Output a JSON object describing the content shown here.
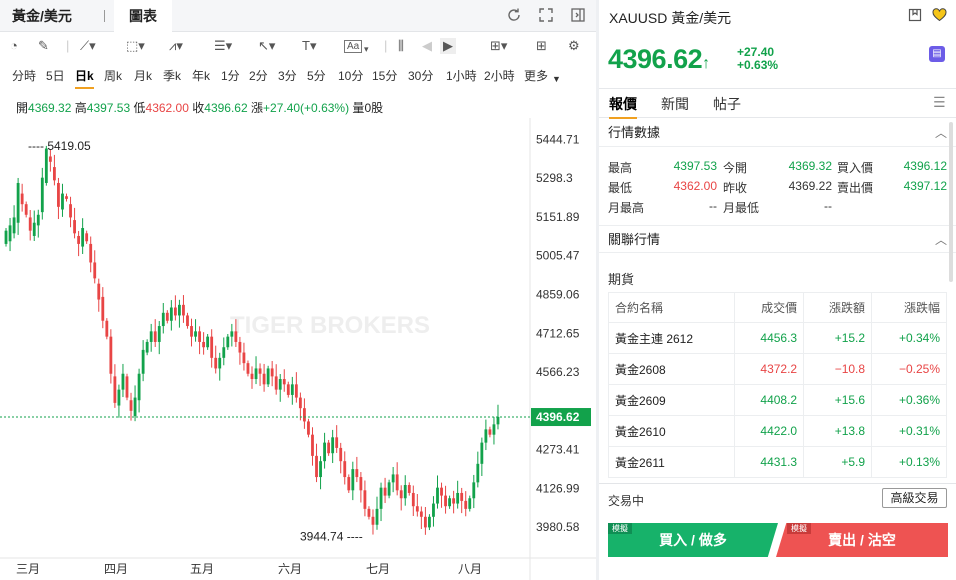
{
  "tabs": [
    {
      "label": "黃金/美元"
    },
    {
      "label": "圖表"
    }
  ],
  "toolbar": {
    "indicator_label": "Aa"
  },
  "periods": [
    "分時",
    "5日",
    "日k",
    "周k",
    "月k",
    "季k",
    "年k",
    "1分",
    "2分",
    "3分",
    "5分",
    "10分",
    "15分",
    "30分",
    "1小時",
    "2小時",
    "更多"
  ],
  "active_period": "日k",
  "ohlc": {
    "open_label": "開",
    "open": "4369.32",
    "high_label": "高",
    "high": "4397.53",
    "low_label": "低",
    "low": "4362.00",
    "close_label": "收",
    "close": "4396.62",
    "change_label": "漲",
    "change": "+27.40(+0.63%)",
    "volume_label": "量",
    "volume": "0股"
  },
  "chart_data": {
    "type": "candlestick",
    "y_ticks": [
      5444.71,
      5298.3,
      5151.89,
      5005.47,
      4859.06,
      4712.65,
      4566.23,
      4273.41,
      4126.99,
      3980.58
    ],
    "ylim": [
      3940,
      5480
    ],
    "x_ticks": [
      "三月",
      "四月",
      "五月",
      "六月",
      "七月",
      "八月"
    ],
    "max_label": "---- 5419.05",
    "min_label": "3944.74 ----",
    "last_price": "4396.62",
    "watermark": "TIGER BROKERS",
    "candles": [
      [
        5050,
        5100
      ],
      [
        5060,
        5120
      ],
      [
        5090,
        5150
      ],
      [
        5130,
        5280
      ],
      [
        5240,
        5200
      ],
      [
        5200,
        5160
      ],
      [
        5150,
        5100
      ],
      [
        5080,
        5130
      ],
      [
        5120,
        5160
      ],
      [
        5170,
        5300
      ],
      [
        5280,
        5410
      ],
      [
        5380,
        5360
      ],
      [
        5340,
        5290
      ],
      [
        5280,
        5190
      ],
      [
        5180,
        5240
      ],
      [
        5230,
        5220
      ],
      [
        5200,
        5150
      ],
      [
        5140,
        5090
      ],
      [
        5080,
        5050
      ],
      [
        5040,
        5110
      ],
      [
        5090,
        5060
      ],
      [
        5050,
        4980
      ],
      [
        4980,
        4920
      ],
      [
        4900,
        4840
      ],
      [
        4850,
        4760
      ],
      [
        4760,
        4700
      ],
      [
        4700,
        4560
      ],
      [
        4550,
        4450
      ],
      [
        4440,
        4500
      ],
      [
        4500,
        4560
      ],
      [
        4550,
        4470
      ],
      [
        4460,
        4420
      ],
      [
        4400,
        4470
      ],
      [
        4460,
        4560
      ],
      [
        4560,
        4650
      ],
      [
        4640,
        4680
      ],
      [
        4680,
        4720
      ],
      [
        4720,
        4680
      ],
      [
        4680,
        4740
      ],
      [
        4740,
        4790
      ],
      [
        4790,
        4760
      ],
      [
        4760,
        4810
      ],
      [
        4810,
        4780
      ],
      [
        4780,
        4820
      ],
      [
        4820,
        4780
      ],
      [
        4780,
        4740
      ],
      [
        4740,
        4700
      ],
      [
        4700,
        4720
      ],
      [
        4720,
        4680
      ],
      [
        4680,
        4660
      ],
      [
        4660,
        4700
      ],
      [
        4700,
        4620
      ],
      [
        4620,
        4580
      ],
      [
        4580,
        4620
      ],
      [
        4620,
        4660
      ],
      [
        4660,
        4700
      ],
      [
        4700,
        4720
      ],
      [
        4720,
        4680
      ],
      [
        4680,
        4640
      ],
      [
        4640,
        4600
      ],
      [
        4600,
        4560
      ],
      [
        4560,
        4540
      ],
      [
        4540,
        4580
      ],
      [
        4580,
        4560
      ],
      [
        4560,
        4520
      ],
      [
        4520,
        4580
      ],
      [
        4580,
        4550
      ],
      [
        4550,
        4500
      ],
      [
        4500,
        4540
      ],
      [
        4540,
        4520
      ],
      [
        4520,
        4480
      ],
      [
        4480,
        4520
      ],
      [
        4520,
        4470
      ],
      [
        4470,
        4430
      ],
      [
        4430,
        4380
      ],
      [
        4380,
        4330
      ],
      [
        4330,
        4250
      ],
      [
        4250,
        4170
      ],
      [
        4170,
        4230
      ],
      [
        4230,
        4300
      ],
      [
        4300,
        4260
      ],
      [
        4260,
        4320
      ],
      [
        4320,
        4280
      ],
      [
        4280,
        4230
      ],
      [
        4230,
        4170
      ],
      [
        4170,
        4120
      ],
      [
        4120,
        4200
      ],
      [
        4200,
        4170
      ],
      [
        4170,
        4120
      ],
      [
        4120,
        4050
      ],
      [
        4050,
        4020
      ],
      [
        4020,
        3990
      ],
      [
        3990,
        4050
      ],
      [
        4050,
        4130
      ],
      [
        4130,
        4100
      ],
      [
        4100,
        4150
      ],
      [
        4150,
        4180
      ],
      [
        4180,
        4120
      ],
      [
        4120,
        4090
      ],
      [
        4090,
        4140
      ],
      [
        4140,
        4110
      ],
      [
        4110,
        4060
      ],
      [
        4060,
        4040
      ],
      [
        4040,
        4020
      ],
      [
        4020,
        3980
      ],
      [
        3980,
        4020
      ],
      [
        4020,
        4070
      ],
      [
        4070,
        4130
      ],
      [
        4130,
        4100
      ],
      [
        4100,
        4060
      ],
      [
        4060,
        4090
      ],
      [
        4090,
        4070
      ],
      [
        4070,
        4110
      ],
      [
        4110,
        4080
      ],
      [
        4080,
        4050
      ],
      [
        4050,
        4090
      ],
      [
        4090,
        4150
      ],
      [
        4150,
        4220
      ],
      [
        4220,
        4300
      ],
      [
        4300,
        4350
      ],
      [
        4350,
        4330
      ],
      [
        4330,
        4369
      ],
      [
        4369,
        4397
      ]
    ]
  },
  "right": {
    "symbol": "XAUUSD 黃金/美元",
    "price": "4396.62",
    "price_arrow": "↑",
    "change": "+27.40",
    "change_pct": "+0.63%",
    "tabs": [
      "報價",
      "新聞",
      "帖子"
    ],
    "sect_quote": "行情數據",
    "quote": [
      {
        "k": "最高",
        "v": "4397.53",
        "c": "green"
      },
      {
        "k": "今開",
        "v": "4369.32",
        "c": "green"
      },
      {
        "k": "買入價",
        "v": "4396.12",
        "c": "green"
      },
      {
        "k": "最低",
        "v": "4362.00",
        "c": "red"
      },
      {
        "k": "昨收",
        "v": "4369.22",
        "c": "dark"
      },
      {
        "k": "賣出價",
        "v": "4397.12",
        "c": "green"
      },
      {
        "k": "月最高",
        "v": "--",
        "c": "dark"
      },
      {
        "k": "月最低",
        "v": "--",
        "c": "dark"
      }
    ],
    "sect_related": "關聯行情",
    "futures_title": "期貨",
    "fut_headers": [
      "合約名稱",
      "成交價",
      "漲跌額",
      "漲跌幅"
    ],
    "futures": [
      {
        "name": "黃金主連 2612",
        "price": "4456.3",
        "chg": "+15.2",
        "pct": "+0.34%",
        "c": "green"
      },
      {
        "name": "黃金2608",
        "price": "4372.2",
        "chg": "−10.8",
        "pct": "−0.25%",
        "c": "red"
      },
      {
        "name": "黃金2609",
        "price": "4408.2",
        "chg": "+15.6",
        "pct": "+0.36%",
        "c": "green"
      },
      {
        "name": "黃金2610",
        "price": "4422.0",
        "chg": "+13.8",
        "pct": "+0.31%",
        "c": "green"
      },
      {
        "name": "黃金2611",
        "price": "4431.3",
        "chg": "+5.9",
        "pct": "+0.13%",
        "c": "green"
      }
    ],
    "trade_status": "交易中",
    "advanced_btn": "高級交易",
    "sim_tag": "模擬",
    "buy_btn": "買入 / 做多",
    "sell_btn": "賣出 / 沽空"
  }
}
